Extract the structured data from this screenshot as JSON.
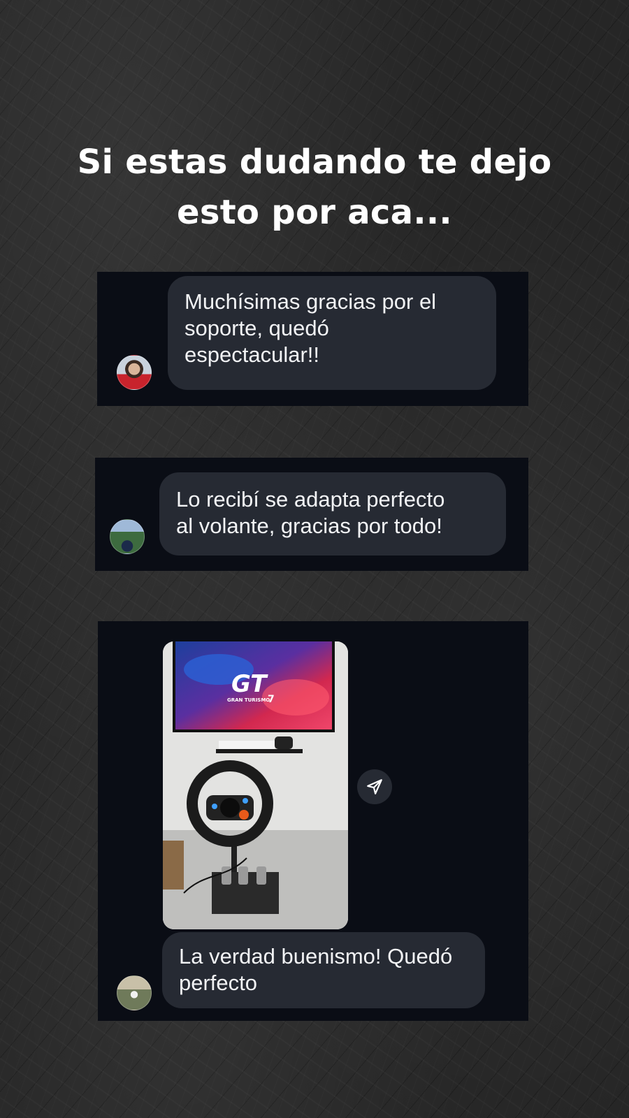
{
  "headline": {
    "line1": "Si estas dudando te dejo",
    "line2": "esto por aca..."
  },
  "messages": [
    {
      "lines": [
        "Muchísimas gracias por el",
        "soporte, quedó",
        "espectacular!!"
      ]
    },
    {
      "lines": [
        "Lo recibí se adapta perfecto",
        "al volante, gracias por todo!"
      ]
    },
    {
      "lines": [
        "La verdad buenismo! Quedó",
        "perfecto"
      ]
    }
  ],
  "photo": {
    "screen_title": "GRAN TURISMO",
    "screen_number": "7"
  },
  "icons": {
    "share": "paper-plane-icon"
  },
  "colors": {
    "card_bg": "#0a0d15",
    "bubble_bg": "#262a33",
    "text": "#f2f3f5"
  }
}
